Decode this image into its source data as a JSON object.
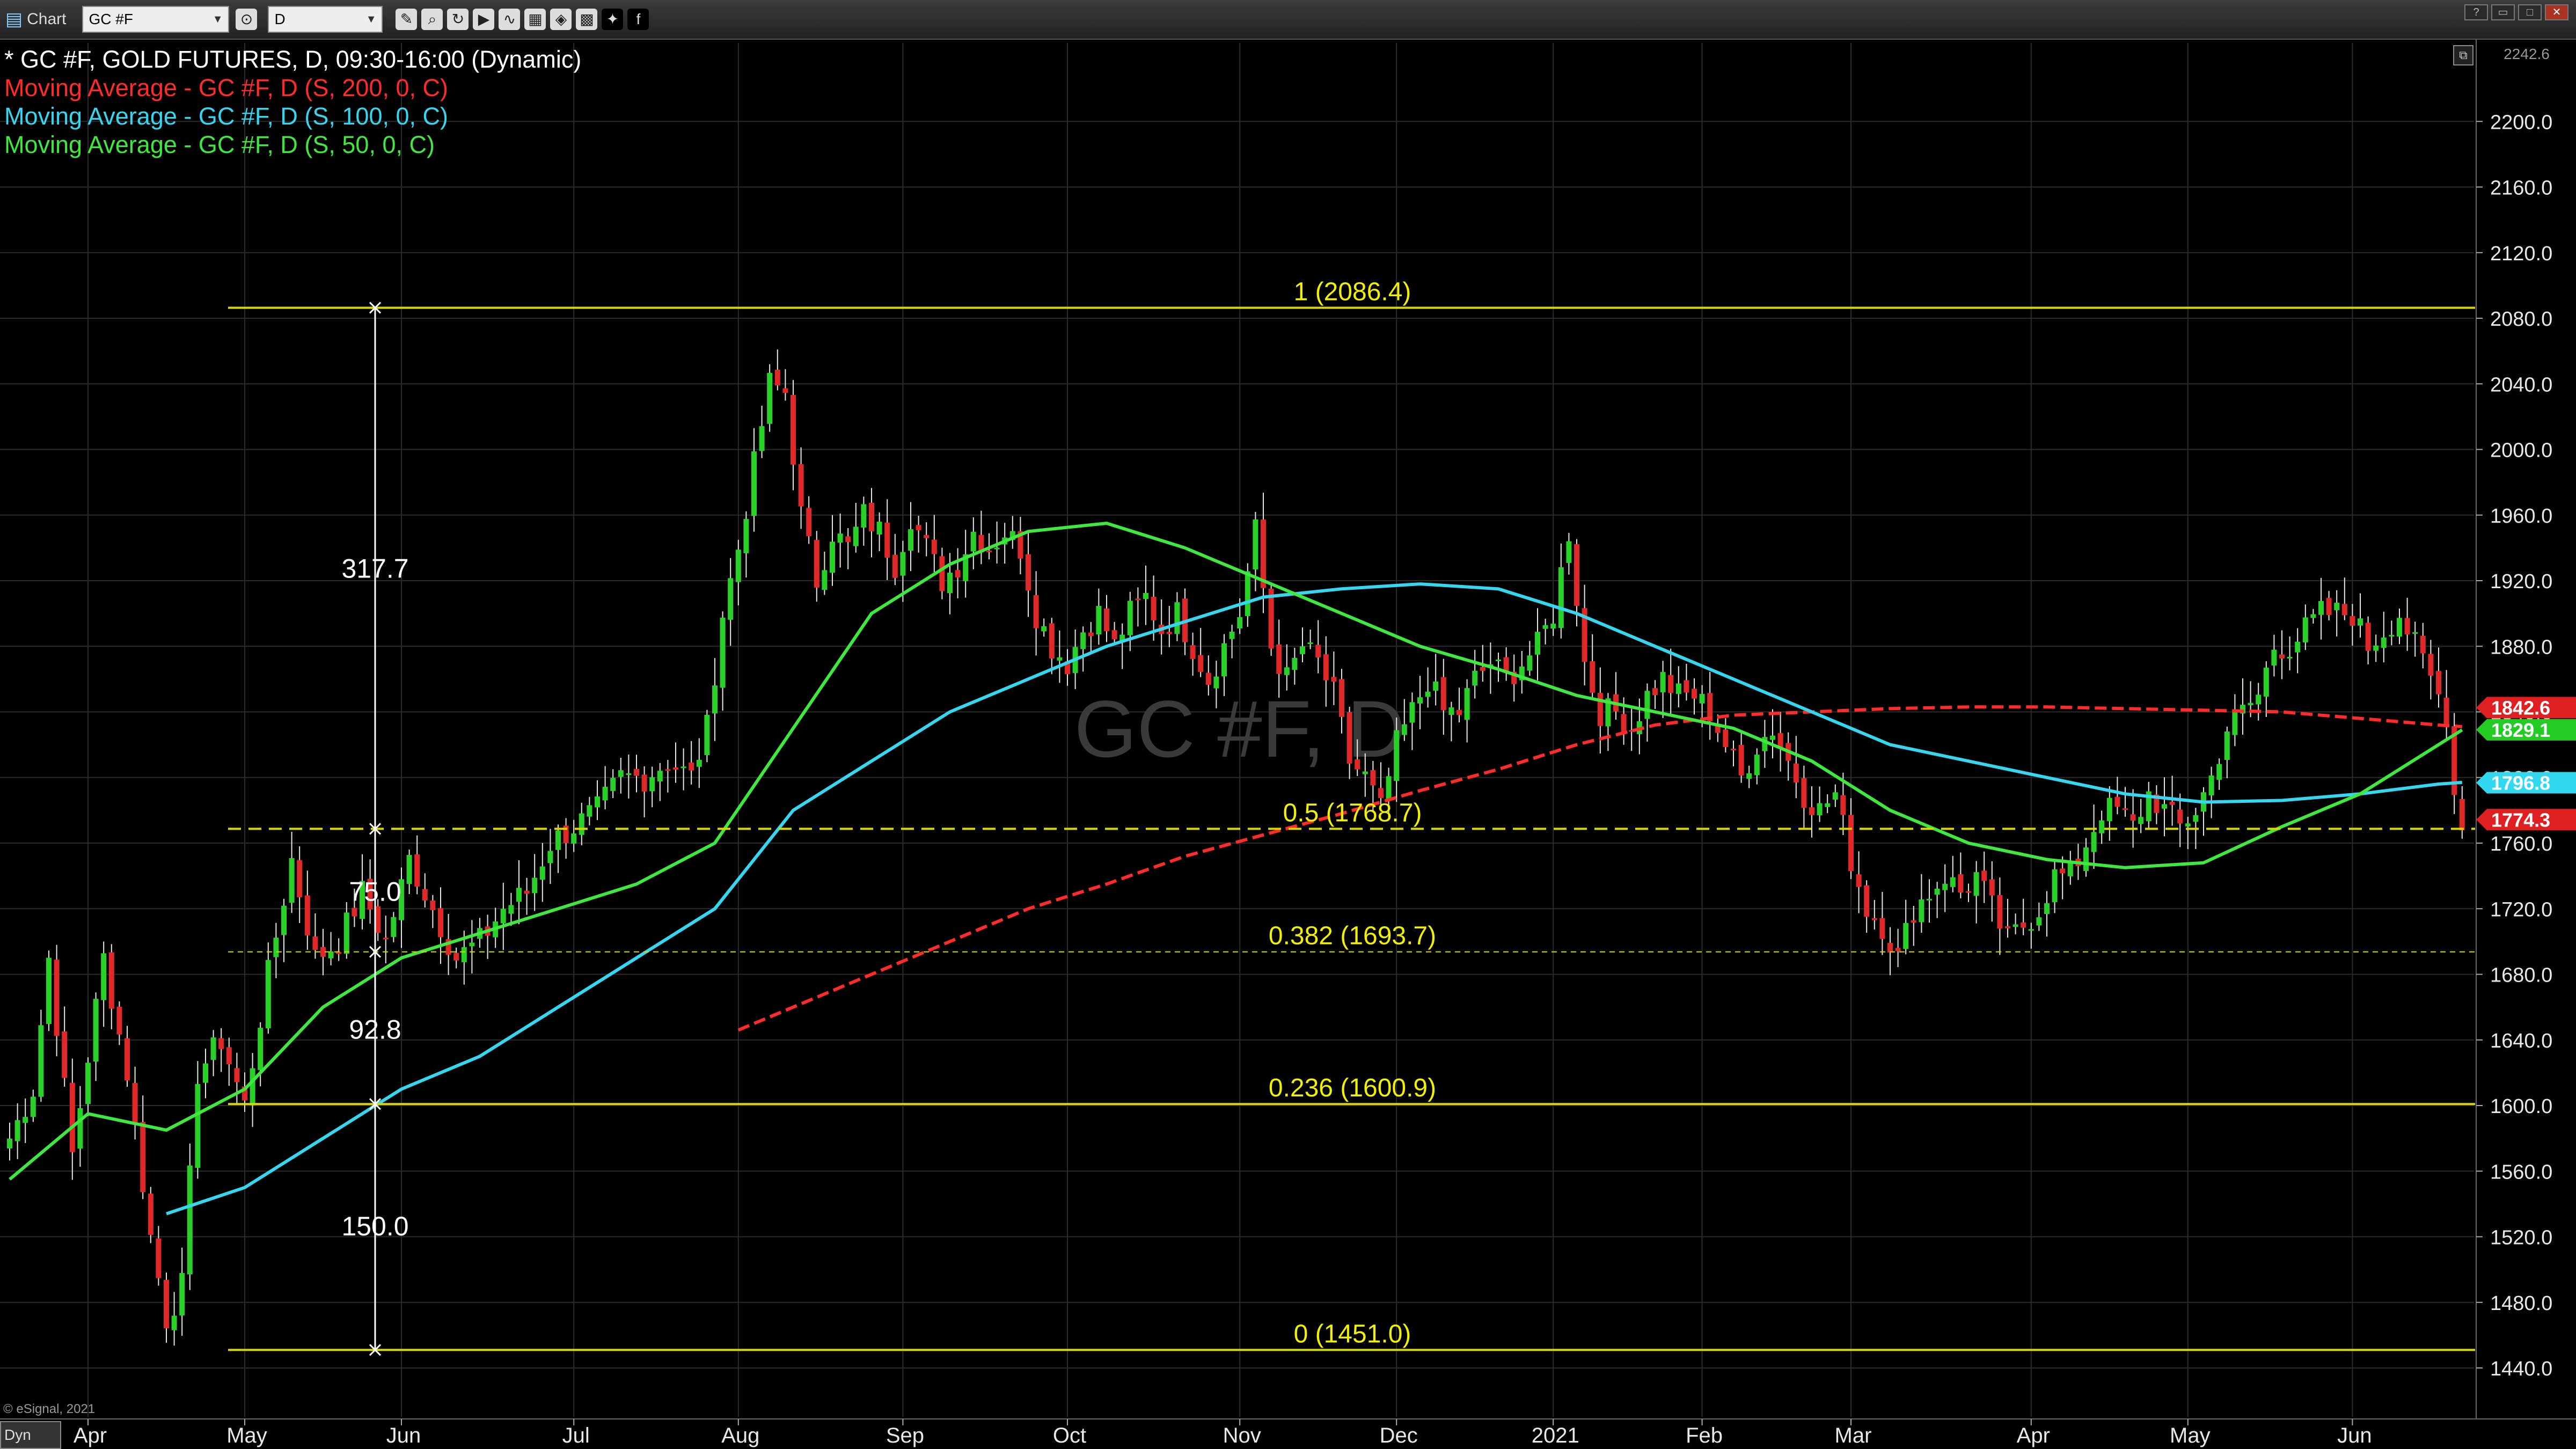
{
  "toolbar": {
    "app_label": "Chart",
    "symbol_value": "GC #F",
    "interval_value": "D",
    "icons": [
      "pencil-icon",
      "zoom-icon",
      "refresh-icon",
      "play-icon",
      "indicator-icon",
      "layout-icon",
      "link-icon",
      "grid-icon",
      "twitter-icon",
      "facebook-icon"
    ],
    "window_controls": [
      "?",
      "▭",
      "□",
      "✕"
    ]
  },
  "legend": [
    {
      "text": "* GC #F, GOLD FUTURES, D, 09:30-16:00 (Dynamic)",
      "color": "#ffffff"
    },
    {
      "text": "Moving Average - GC #F, D (S, 200, 0, C)",
      "color": "#ff2a2a"
    },
    {
      "text": "Moving Average - GC #F, D (S, 100, 0, C)",
      "color": "#34d6f0"
    },
    {
      "text": "Moving Average - GC #F, D (S, 50, 0, C)",
      "color": "#3ee83e"
    }
  ],
  "watermark": "GC #F, D",
  "copyright": "© eSignal, 2021",
  "dyn_label": "Dyn",
  "colors": {
    "bull": "#28d028",
    "bear": "#e02828",
    "ma200": "#ff2a2a",
    "ma100": "#34d6f0",
    "ma50": "#3ee83e",
    "fib": "#d8d800",
    "grid": "#2b2b2b"
  },
  "chart_data": {
    "type": "candlestick",
    "title": "GC #F, GOLD FUTURES, D, 09:30-16:00 (Dynamic)",
    "y_axis": {
      "min": 1420,
      "max": 2250,
      "ticks": [
        "2200.0",
        "2160.0",
        "2120.0",
        "2080.0",
        "2040.0",
        "2000.0",
        "1960.0",
        "1920.0",
        "1880.0",
        "1840.0",
        "1800.0",
        "1760.0",
        "1720.0",
        "1680.0",
        "1640.0",
        "1600.0",
        "1560.0",
        "1520.0",
        "1480.0",
        "1440.0"
      ],
      "top_label": "2242.6"
    },
    "x_axis": {
      "months": [
        {
          "label": "Apr",
          "index": 10
        },
        {
          "label": "May",
          "index": 30
        },
        {
          "label": "Jun",
          "index": 50
        },
        {
          "label": "Jul",
          "index": 72
        },
        {
          "label": "Aug",
          "index": 93
        },
        {
          "label": "Sep",
          "index": 114
        },
        {
          "label": "Oct",
          "index": 135
        },
        {
          "label": "Nov",
          "index": 157
        },
        {
          "label": "Dec",
          "index": 177
        },
        {
          "label": "2021",
          "index": 197
        },
        {
          "label": "Feb",
          "index": 216
        },
        {
          "label": "Mar",
          "index": 235
        },
        {
          "label": "Apr",
          "index": 258
        },
        {
          "label": "May",
          "index": 278
        },
        {
          "label": "Jun",
          "index": 299
        }
      ],
      "total_bars": 314
    },
    "price_anchors": [
      [
        0,
        1580
      ],
      [
        3,
        1610
      ],
      [
        5,
        1690
      ],
      [
        8,
        1570
      ],
      [
        12,
        1690
      ],
      [
        15,
        1620
      ],
      [
        18,
        1520
      ],
      [
        20,
        1470
      ],
      [
        22,
        1490
      ],
      [
        24,
        1620
      ],
      [
        27,
        1640
      ],
      [
        30,
        1600
      ],
      [
        33,
        1680
      ],
      [
        36,
        1750
      ],
      [
        39,
        1690
      ],
      [
        42,
        1700
      ],
      [
        45,
        1730
      ],
      [
        48,
        1700
      ],
      [
        51,
        1750
      ],
      [
        54,
        1720
      ],
      [
        57,
        1690
      ],
      [
        60,
        1700
      ],
      [
        63,
        1720
      ],
      [
        66,
        1730
      ],
      [
        69,
        1760
      ],
      [
        72,
        1770
      ],
      [
        75,
        1780
      ],
      [
        78,
        1800
      ],
      [
        81,
        1800
      ],
      [
        84,
        1810
      ],
      [
        87,
        1800
      ],
      [
        89,
        1830
      ],
      [
        91,
        1900
      ],
      [
        93,
        1940
      ],
      [
        95,
        1990
      ],
      [
        97,
        2040
      ],
      [
        99,
        2035
      ],
      [
        101,
        1960
      ],
      [
        103,
        1920
      ],
      [
        105,
        1950
      ],
      [
        107,
        1940
      ],
      [
        109,
        1960
      ],
      [
        111,
        1950
      ],
      [
        113,
        1930
      ],
      [
        115,
        1960
      ],
      [
        117,
        1940
      ],
      [
        119,
        1920
      ],
      [
        121,
        1930
      ],
      [
        123,
        1950
      ],
      [
        125,
        1940
      ],
      [
        127,
        1950
      ],
      [
        129,
        1940
      ],
      [
        131,
        1900
      ],
      [
        133,
        1880
      ],
      [
        135,
        1870
      ],
      [
        137,
        1890
      ],
      [
        139,
        1900
      ],
      [
        141,
        1880
      ],
      [
        143,
        1900
      ],
      [
        145,
        1910
      ],
      [
        147,
        1890
      ],
      [
        149,
        1900
      ],
      [
        151,
        1880
      ],
      [
        153,
        1860
      ],
      [
        155,
        1880
      ],
      [
        157,
        1900
      ],
      [
        159,
        1950
      ],
      [
        161,
        1880
      ],
      [
        163,
        1860
      ],
      [
        165,
        1880
      ],
      [
        167,
        1870
      ],
      [
        169,
        1850
      ],
      [
        171,
        1810
      ],
      [
        173,
        1800
      ],
      [
        175,
        1780
      ],
      [
        177,
        1820
      ],
      [
        179,
        1840
      ],
      [
        181,
        1860
      ],
      [
        183,
        1840
      ],
      [
        185,
        1840
      ],
      [
        187,
        1860
      ],
      [
        189,
        1870
      ],
      [
        191,
        1860
      ],
      [
        193,
        1870
      ],
      [
        195,
        1880
      ],
      [
        197,
        1900
      ],
      [
        199,
        1950
      ],
      [
        201,
        1870
      ],
      [
        203,
        1840
      ],
      [
        205,
        1840
      ],
      [
        207,
        1830
      ],
      [
        209,
        1850
      ],
      [
        211,
        1860
      ],
      [
        213,
        1850
      ],
      [
        215,
        1850
      ],
      [
        217,
        1840
      ],
      [
        219,
        1820
      ],
      [
        221,
        1800
      ],
      [
        223,
        1820
      ],
      [
        225,
        1830
      ],
      [
        227,
        1810
      ],
      [
        229,
        1790
      ],
      [
        231,
        1780
      ],
      [
        233,
        1790
      ],
      [
        235,
        1750
      ],
      [
        237,
        1720
      ],
      [
        239,
        1710
      ],
      [
        241,
        1690
      ],
      [
        243,
        1720
      ],
      [
        245,
        1730
      ],
      [
        247,
        1740
      ],
      [
        249,
        1730
      ],
      [
        251,
        1740
      ],
      [
        253,
        1720
      ],
      [
        255,
        1700
      ],
      [
        257,
        1710
      ],
      [
        259,
        1720
      ],
      [
        261,
        1740
      ],
      [
        263,
        1740
      ],
      [
        265,
        1760
      ],
      [
        267,
        1780
      ],
      [
        269,
        1780
      ],
      [
        271,
        1770
      ],
      [
        273,
        1790
      ],
      [
        275,
        1780
      ],
      [
        277,
        1770
      ],
      [
        279,
        1780
      ],
      [
        281,
        1800
      ],
      [
        283,
        1830
      ],
      [
        285,
        1840
      ],
      [
        287,
        1850
      ],
      [
        289,
        1880
      ],
      [
        291,
        1880
      ],
      [
        293,
        1890
      ],
      [
        295,
        1900
      ],
      [
        297,
        1900
      ],
      [
        299,
        1900
      ],
      [
        301,
        1880
      ],
      [
        303,
        1890
      ],
      [
        305,
        1900
      ],
      [
        307,
        1880
      ],
      [
        309,
        1860
      ],
      [
        311,
        1840
      ],
      [
        312,
        1790
      ],
      [
        313,
        1774
      ]
    ],
    "moving_averages": [
      {
        "name": "Moving Average - GC #F, D (S, 200, 0, C)",
        "period": 200,
        "color": "#ff2a2a",
        "dashed": true,
        "points": [
          [
            93,
            1646
          ],
          [
            100,
            1660
          ],
          [
            110,
            1680
          ],
          [
            120,
            1700
          ],
          [
            130,
            1720
          ],
          [
            140,
            1735
          ],
          [
            150,
            1752
          ],
          [
            160,
            1765
          ],
          [
            170,
            1778
          ],
          [
            180,
            1792
          ],
          [
            190,
            1805
          ],
          [
            200,
            1820
          ],
          [
            210,
            1832
          ],
          [
            220,
            1838
          ],
          [
            230,
            1840
          ],
          [
            240,
            1842
          ],
          [
            250,
            1843
          ],
          [
            260,
            1843
          ],
          [
            270,
            1842
          ],
          [
            280,
            1841
          ],
          [
            290,
            1840
          ],
          [
            300,
            1836
          ],
          [
            310,
            1832
          ],
          [
            313,
            1831
          ]
        ]
      },
      {
        "name": "Moving Average - GC #F, D (S, 100, 0, C)",
        "period": 100,
        "color": "#34d6f0",
        "dashed": false,
        "points": [
          [
            20,
            1534
          ],
          [
            30,
            1550
          ],
          [
            40,
            1580
          ],
          [
            50,
            1610
          ],
          [
            60,
            1630
          ],
          [
            70,
            1660
          ],
          [
            80,
            1690
          ],
          [
            90,
            1720
          ],
          [
            100,
            1780
          ],
          [
            110,
            1810
          ],
          [
            120,
            1840
          ],
          [
            130,
            1860
          ],
          [
            140,
            1880
          ],
          [
            150,
            1895
          ],
          [
            160,
            1910
          ],
          [
            170,
            1915
          ],
          [
            180,
            1918
          ],
          [
            190,
            1915
          ],
          [
            200,
            1900
          ],
          [
            210,
            1880
          ],
          [
            220,
            1860
          ],
          [
            230,
            1840
          ],
          [
            240,
            1820
          ],
          [
            250,
            1810
          ],
          [
            260,
            1800
          ],
          [
            270,
            1790
          ],
          [
            280,
            1785
          ],
          [
            290,
            1786
          ],
          [
            300,
            1790
          ],
          [
            310,
            1796
          ],
          [
            313,
            1797
          ]
        ]
      },
      {
        "name": "Moving Average - GC #F, D (S, 50, 0, C)",
        "period": 50,
        "color": "#3ee83e",
        "dashed": false,
        "points": [
          [
            0,
            1555
          ],
          [
            10,
            1595
          ],
          [
            20,
            1585
          ],
          [
            30,
            1610
          ],
          [
            40,
            1660
          ],
          [
            50,
            1690
          ],
          [
            60,
            1705
          ],
          [
            70,
            1720
          ],
          [
            80,
            1735
          ],
          [
            90,
            1760
          ],
          [
            100,
            1830
          ],
          [
            110,
            1900
          ],
          [
            120,
            1930
          ],
          [
            130,
            1950
          ],
          [
            140,
            1955
          ],
          [
            150,
            1940
          ],
          [
            160,
            1920
          ],
          [
            170,
            1900
          ],
          [
            180,
            1880
          ],
          [
            190,
            1866
          ],
          [
            200,
            1850
          ],
          [
            210,
            1840
          ],
          [
            220,
            1830
          ],
          [
            230,
            1810
          ],
          [
            240,
            1780
          ],
          [
            250,
            1760
          ],
          [
            260,
            1750
          ],
          [
            270,
            1745
          ],
          [
            280,
            1748
          ],
          [
            290,
            1770
          ],
          [
            300,
            1790
          ],
          [
            310,
            1820
          ],
          [
            313,
            1829
          ]
        ]
      }
    ],
    "fibonacci": {
      "color": "#d8d800",
      "levels": [
        {
          "label": "1 (2086.4)",
          "value": 2086.4,
          "style": "solid"
        },
        {
          "label": "0.5 (1768.7)",
          "value": 1768.7,
          "style": "dashed"
        },
        {
          "label": "0.382 (1693.7)",
          "value": 1693.7,
          "style": "dashed-thin"
        },
        {
          "label": "0.236 (1600.9)",
          "value": 1600.9,
          "style": "solid"
        },
        {
          "label": "0 (1451.0)",
          "value": 1451.0,
          "style": "solid"
        }
      ],
      "measure_values": [
        {
          "label": "317.7",
          "value": 1927
        },
        {
          "label": "75.0",
          "value": 1730
        },
        {
          "label": "92.8",
          "value": 1646
        },
        {
          "label": "150.0",
          "value": 1526
        }
      ]
    },
    "price_tags": [
      {
        "label": "1842.6",
        "value": 1842.6,
        "color": "#e02020"
      },
      {
        "label": "1829.1",
        "value": 1829.1,
        "color": "#22cc22"
      },
      {
        "label": "1796.8",
        "value": 1796.8,
        "color": "#30d8f0"
      },
      {
        "label": "1774.3",
        "value": 1774.3,
        "color": "#e02020"
      }
    ]
  }
}
